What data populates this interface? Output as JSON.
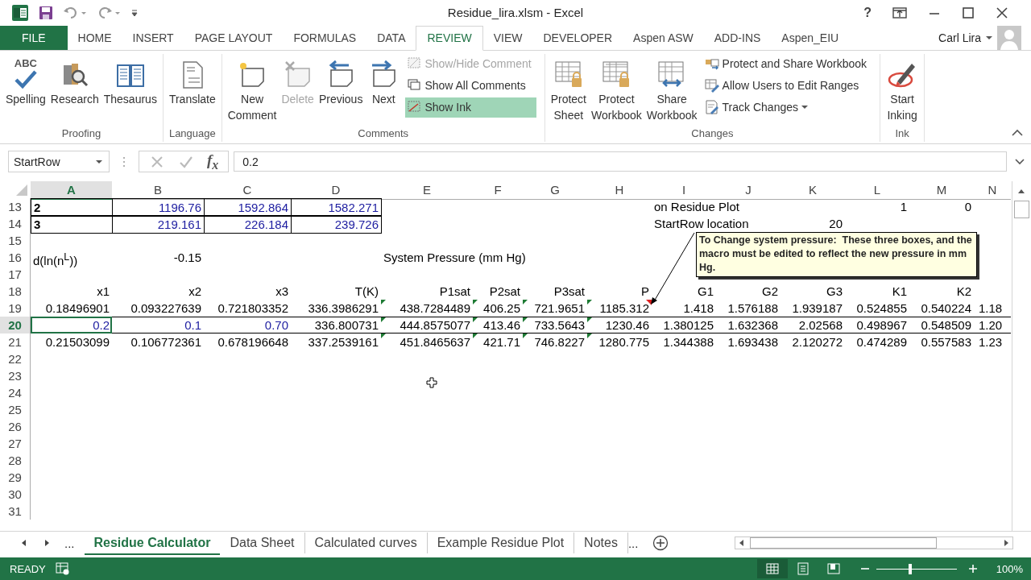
{
  "window": {
    "title": "Residue_lira.xlsm - Excel",
    "help": "?"
  },
  "ribbon_tabs": [
    {
      "label": "FILE",
      "kind": "file",
      "selected": false
    },
    {
      "label": "HOME",
      "kind": "tab",
      "selected": false
    },
    {
      "label": "INSERT",
      "kind": "tab",
      "selected": false
    },
    {
      "label": "PAGE LAYOUT",
      "kind": "tab",
      "selected": false
    },
    {
      "label": "FORMULAS",
      "kind": "tab",
      "selected": false
    },
    {
      "label": "DATA",
      "kind": "tab",
      "selected": false
    },
    {
      "label": "REVIEW",
      "kind": "tab",
      "selected": true
    },
    {
      "label": "VIEW",
      "kind": "tab",
      "selected": false
    },
    {
      "label": "DEVELOPER",
      "kind": "tab",
      "selected": false
    },
    {
      "label": "Aspen ASW",
      "kind": "tab",
      "selected": false
    },
    {
      "label": "ADD-INS",
      "kind": "tab",
      "selected": false
    },
    {
      "label": "Aspen_EIU",
      "kind": "tab",
      "selected": false
    }
  ],
  "account": {
    "user": "Carl Lira"
  },
  "ribbon_groups": [
    {
      "label": "Proofing",
      "buttons": [
        {
          "label": "Spelling",
          "icon_text": "ABC",
          "kind": "large",
          "disabled": false,
          "on": false,
          "dropdown": false
        },
        {
          "label": "Research",
          "kind": "large",
          "disabled": false,
          "on": false,
          "dropdown": false
        },
        {
          "label": "Thesaurus",
          "kind": "large",
          "disabled": false,
          "on": false,
          "dropdown": false
        }
      ]
    },
    {
      "label": "Language",
      "buttons": [
        {
          "label": "Translate",
          "kind": "large",
          "disabled": false,
          "on": false,
          "dropdown": false
        }
      ]
    },
    {
      "label": "Comments",
      "buttons": [
        {
          "label": "New\nComment",
          "kind": "large",
          "disabled": false,
          "on": false,
          "dropdown": false
        },
        {
          "label": "Delete",
          "kind": "large",
          "disabled": true,
          "on": false,
          "dropdown": false
        },
        {
          "label": "Previous",
          "kind": "large",
          "disabled": false,
          "on": false,
          "dropdown": false
        },
        {
          "label": "Next",
          "kind": "large",
          "disabled": false,
          "on": false,
          "dropdown": false
        },
        {
          "label": "Show/Hide Comment",
          "kind": "small",
          "disabled": true,
          "on": false,
          "dropdown": false
        },
        {
          "label": "Show All Comments",
          "kind": "small",
          "disabled": false,
          "on": false,
          "dropdown": false
        },
        {
          "label": "Show Ink",
          "kind": "small",
          "disabled": false,
          "on": true,
          "dropdown": false
        }
      ]
    },
    {
      "label": "Changes",
      "buttons": [
        {
          "label": "Protect\nSheet",
          "kind": "large",
          "disabled": false,
          "on": false,
          "dropdown": false
        },
        {
          "label": "Protect\nWorkbook",
          "kind": "large",
          "disabled": false,
          "on": false,
          "dropdown": false
        },
        {
          "label": "Share\nWorkbook",
          "kind": "large",
          "disabled": false,
          "on": false,
          "dropdown": false
        },
        {
          "label": "Protect and Share Workbook",
          "kind": "small",
          "disabled": false,
          "on": false,
          "dropdown": false
        },
        {
          "label": "Allow Users to Edit Ranges",
          "kind": "small",
          "disabled": false,
          "on": false,
          "dropdown": false
        },
        {
          "label": "Track Changes",
          "kind": "small",
          "disabled": false,
          "on": false,
          "dropdown": true
        }
      ]
    },
    {
      "label": "Ink",
      "buttons": [
        {
          "label": "Start\nInking",
          "kind": "large",
          "disabled": false,
          "on": false,
          "dropdown": false
        }
      ]
    }
  ],
  "formula_bar": {
    "name_box": "StartRow",
    "insert_function": "f$_{x}$",
    "formula": "0.2"
  },
  "sheet": {
    "columns": [
      {
        "letter": "A",
        "selected": true
      },
      {
        "letter": "B",
        "selected": false
      },
      {
        "letter": "C",
        "selected": false
      },
      {
        "letter": "D",
        "selected": false
      },
      {
        "letter": "E",
        "selected": false
      },
      {
        "letter": "F",
        "selected": false
      },
      {
        "letter": "G",
        "selected": false
      },
      {
        "letter": "H",
        "selected": false
      },
      {
        "letter": "I",
        "selected": false
      },
      {
        "letter": "J",
        "selected": false
      },
      {
        "letter": "K",
        "selected": false
      },
      {
        "letter": "L",
        "selected": false
      },
      {
        "letter": "M",
        "selected": false
      },
      {
        "letter": "N",
        "selected": false
      }
    ],
    "rows": [
      {
        "number": "13",
        "selected": false,
        "framed": false,
        "cells": [
          {
            "text": "2",
            "kind": "bold",
            "boxed": true
          },
          {
            "text": "1196.76",
            "kind": "input",
            "boxed": true
          },
          {
            "text": "1592.864",
            "kind": "input",
            "boxed": true
          },
          {
            "text": "1582.271",
            "kind": "input",
            "boxed": true
          },
          null,
          null,
          null,
          null,
          {
            "text": "on Residue Plot",
            "kind": "label",
            "boxed": false
          },
          null,
          null,
          {
            "text": "1",
            "kind": "number",
            "boxed": false
          },
          {
            "text": "0",
            "kind": "number",
            "boxed": false
          }
        ]
      },
      {
        "number": "14",
        "selected": false,
        "framed": false,
        "cells": [
          {
            "text": "3",
            "kind": "bold",
            "boxed": true
          },
          {
            "text": "219.161",
            "kind": "input",
            "boxed": true
          },
          {
            "text": "226.184",
            "kind": "input",
            "boxed": true
          },
          {
            "text": "239.726",
            "kind": "input",
            "boxed": true
          },
          null,
          null,
          null,
          null,
          {
            "text": "StartRow location",
            "kind": "label",
            "boxed": false
          },
          null,
          {
            "text": "20",
            "kind": "number",
            "boxed": false
          }
        ]
      },
      {
        "number": "15",
        "selected": false,
        "framed": false
      },
      {
        "number": "16",
        "selected": false,
        "framed": false,
        "cells": [
          {
            "text": "d(ln(n$^{L}$))",
            "kind": "label"
          },
          {
            "text": "-0.15",
            "kind": "number"
          },
          null,
          null,
          {
            "text": "System Pressure (mm Hg)",
            "kind": "label"
          }
        ]
      },
      {
        "number": "17",
        "selected": false,
        "framed": false
      },
      {
        "number": "18",
        "selected": false,
        "framed": false,
        "cells": [
          {
            "text": "x1",
            "kind": "number"
          },
          {
            "text": "x2",
            "kind": "number"
          },
          {
            "text": "x3",
            "kind": "number"
          },
          {
            "text": "T(K)",
            "kind": "number"
          },
          {
            "text": "P1sat",
            "kind": "number"
          },
          {
            "text": "P2sat",
            "kind": "number"
          },
          {
            "text": "P3sat",
            "kind": "number"
          },
          {
            "text": "P",
            "kind": "number"
          },
          {
            "text": "G1",
            "kind": "number"
          },
          {
            "text": "G2",
            "kind": "number"
          },
          {
            "text": "G3",
            "kind": "number"
          },
          {
            "text": "K1",
            "kind": "number"
          },
          {
            "text": "K2",
            "kind": "number"
          }
        ]
      },
      {
        "number": "19",
        "selected": false,
        "framed": false,
        "cells": [
          {
            "text": "0.18496901",
            "kind": "number",
            "flag": false,
            "comment": false
          },
          {
            "text": "0.093227639",
            "kind": "number",
            "flag": false,
            "comment": false
          },
          {
            "text": "0.721803352",
            "kind": "number",
            "flag": false,
            "comment": false
          },
          {
            "text": "336.3986291",
            "kind": "number",
            "flag": false,
            "comment": false
          },
          {
            "text": "438.7284489",
            "kind": "number",
            "flag": true,
            "comment": false
          },
          {
            "text": "406.25",
            "kind": "number",
            "flag": true,
            "comment": false
          },
          {
            "text": "721.9651",
            "kind": "number",
            "flag": true,
            "comment": false
          },
          {
            "text": "1185.312",
            "kind": "number",
            "flag": true,
            "comment": true
          },
          {
            "text": "1.418",
            "kind": "number",
            "flag": false,
            "comment": false
          },
          {
            "text": "1.576188",
            "kind": "number",
            "flag": false,
            "comment": false
          },
          {
            "text": "1.939187",
            "kind": "number",
            "flag": false,
            "comment": false
          },
          {
            "text": "0.524855",
            "kind": "number",
            "flag": false,
            "comment": false
          },
          {
            "text": "0.540224",
            "kind": "number",
            "flag": false,
            "comment": false
          },
          {
            "text": "1.18",
            "kind": "cut",
            "flag": false,
            "comment": false
          }
        ]
      },
      {
        "number": "20",
        "selected": true,
        "framed": true,
        "cells": [
          {
            "text": "0.2",
            "kind": "input",
            "active": true,
            "flag": false,
            "comment": false
          },
          {
            "text": "0.1",
            "kind": "input",
            "active": false,
            "flag": false,
            "comment": false
          },
          {
            "text": "0.70",
            "kind": "input",
            "active": false,
            "flag": false,
            "comment": false
          },
          {
            "text": "336.800731",
            "kind": "number",
            "active": false,
            "flag": false,
            "comment": false
          },
          {
            "text": "444.8575077",
            "kind": "number",
            "active": false,
            "flag": true,
            "comment": false
          },
          {
            "text": "413.46",
            "kind": "number",
            "active": false,
            "flag": true,
            "comment": false
          },
          {
            "text": "733.5643",
            "kind": "number",
            "active": false,
            "flag": true,
            "comment": false
          },
          {
            "text": "1230.46",
            "kind": "number",
            "active": false,
            "flag": true,
            "comment": false
          },
          {
            "text": "1.380125",
            "kind": "number",
            "active": false,
            "flag": false,
            "comment": false
          },
          {
            "text": "1.632368",
            "kind": "number",
            "active": false,
            "flag": false,
            "comment": false
          },
          {
            "text": "2.02568",
            "kind": "number",
            "active": false,
            "flag": false,
            "comment": false
          },
          {
            "text": "0.498967",
            "kind": "number",
            "active": false,
            "flag": false,
            "comment": false
          },
          {
            "text": "0.548509",
            "kind": "number",
            "active": false,
            "flag": false,
            "comment": false
          },
          {
            "text": "1.20",
            "kind": "cut",
            "active": false,
            "flag": false,
            "comment": false
          }
        ]
      },
      {
        "number": "21",
        "selected": false,
        "framed": false,
        "cells": [
          {
            "text": "0.21503099",
            "kind": "number",
            "flag": false,
            "comment": false
          },
          {
            "text": "0.106772361",
            "kind": "number",
            "flag": false,
            "comment": false
          },
          {
            "text": "0.678196648",
            "kind": "number",
            "flag": false,
            "comment": false
          },
          {
            "text": "337.2539161",
            "kind": "number",
            "flag": false,
            "comment": false
          },
          {
            "text": "451.8465637",
            "kind": "number",
            "flag": true,
            "comment": false
          },
          {
            "text": "421.71",
            "kind": "number",
            "flag": true,
            "comment": false
          },
          {
            "text": "746.8227",
            "kind": "number",
            "flag": true,
            "comment": false
          },
          {
            "text": "1280.775",
            "kind": "number",
            "flag": true,
            "comment": false
          },
          {
            "text": "1.344388",
            "kind": "number",
            "flag": false,
            "comment": false
          },
          {
            "text": "1.693438",
            "kind": "number",
            "flag": false,
            "comment": false
          },
          {
            "text": "2.120272",
            "kind": "number",
            "flag": false,
            "comment": false
          },
          {
            "text": "0.474289",
            "kind": "number",
            "flag": false,
            "comment": false
          },
          {
            "text": "0.557583",
            "kind": "number",
            "flag": false,
            "comment": false
          },
          {
            "text": "1.23",
            "kind": "cut",
            "flag": false,
            "comment": false
          }
        ]
      },
      {
        "number": "22",
        "selected": false,
        "framed": false
      },
      {
        "number": "23",
        "selected": false,
        "framed": false
      },
      {
        "number": "24",
        "selected": false,
        "framed": false
      },
      {
        "number": "25",
        "selected": false,
        "framed": false
      },
      {
        "number": "26",
        "selected": false,
        "framed": false
      },
      {
        "number": "27",
        "selected": false,
        "framed": false
      },
      {
        "number": "28",
        "selected": false,
        "framed": false
      },
      {
        "number": "29",
        "selected": false,
        "framed": false
      },
      {
        "number": "30",
        "selected": false,
        "framed": false
      },
      {
        "number": "31",
        "selected": false,
        "framed": false
      }
    ],
    "comment": {
      "text": "To Change system pressure:  These three boxes, and the macro must be edited to reflect the new pressure in mm Hg."
    }
  },
  "sheet_tabs": {
    "overflow_left": "...",
    "tabs": [
      {
        "label": "Residue Calculator",
        "selected": true
      },
      {
        "label": "Data Sheet",
        "selected": false
      },
      {
        "label": "Calculated curves",
        "selected": false
      },
      {
        "label": "Example Residue Plot",
        "selected": false
      },
      {
        "label": "Notes",
        "selected": false
      }
    ],
    "overflow_right": "..."
  },
  "status_bar": {
    "mode": "READY",
    "views": [
      {
        "kind": "normal",
        "selected": true
      },
      {
        "kind": "page-layout",
        "selected": false
      },
      {
        "kind": "page-break",
        "selected": false
      }
    ],
    "zoom": {
      "level": 0.42,
      "reading": "100%"
    }
  }
}
